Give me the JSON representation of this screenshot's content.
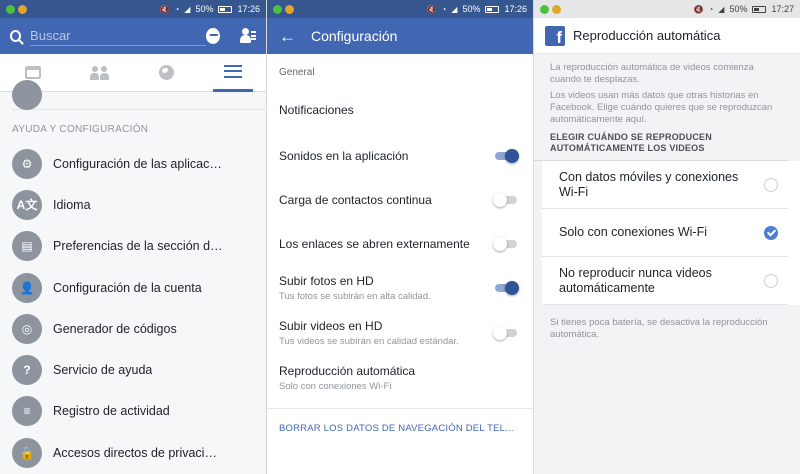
{
  "status_left": {
    "battery": "50%",
    "time": "17:26"
  },
  "status_mid": {
    "battery": "50%",
    "time": "17:26"
  },
  "status_right": {
    "battery": "50%",
    "time": "17:27"
  },
  "menu_screen": {
    "search": {
      "placeholder": "Buscar"
    },
    "section_title": "AYUDA Y CONFIGURACIÓN",
    "items": [
      {
        "label": "Configuración de las aplicacio…",
        "icon": "gear-icon",
        "glyph": "⚙"
      },
      {
        "label": "Idioma",
        "icon": "language-icon",
        "glyph": "A文"
      },
      {
        "label": "Preferencias de la sección de…",
        "icon": "news-feed-preferences-icon",
        "glyph": "▤"
      },
      {
        "label": "Configuración de la cuenta",
        "icon": "account-settings-icon",
        "glyph": "👤"
      },
      {
        "label": "Generador de códigos",
        "icon": "code-generator-icon",
        "glyph": "◎"
      },
      {
        "label": "Servicio de ayuda",
        "icon": "help-icon",
        "glyph": "?"
      },
      {
        "label": "Registro de actividad",
        "icon": "activity-log-icon",
        "glyph": "≡"
      },
      {
        "label": "Accesos directos de privacidad",
        "icon": "privacy-lock-icon",
        "glyph": "🔒"
      }
    ]
  },
  "settings_screen": {
    "title": "Configuración",
    "section": "General",
    "rows": [
      {
        "title": "Notificaciones",
        "subtitle": "",
        "toggle": null
      },
      {
        "title": "Sonidos en la aplicación",
        "subtitle": "",
        "toggle": true
      },
      {
        "title": "Carga de contactos continua",
        "subtitle": "",
        "toggle": false
      },
      {
        "title": "Los enlaces se abren externamente",
        "subtitle": "",
        "toggle": false
      },
      {
        "title": "Subir fotos en HD",
        "subtitle": "Tus fotos se subirán en alta calidad.",
        "toggle": true
      },
      {
        "title": "Subir videos en HD",
        "subtitle": "Tus videos se subirán en calidad estándar.",
        "toggle": false
      },
      {
        "title": "Reproducción automática",
        "subtitle": "Solo con conexiones Wi-Fi",
        "toggle": null
      }
    ],
    "clear_link": "BORRAR LOS DATOS DE NAVEGACIÓN DEL TELÉF…"
  },
  "autoplay_screen": {
    "title": "Reproducción automática",
    "desc1": "La reproducción automática de videos comienza cuando te desplazas.",
    "desc2": "Los videos usan más datos que otras historias en Facebook. Elige cuándo quieres que se reproduzcan automáticamente aquí.",
    "choose_header": "ELEGIR CUÁNDO SE REPRODUCEN AUTOMÁTICAMENTE LOS VIDEOS",
    "options": [
      {
        "label": "Con datos móviles y conexiones Wi-Fi",
        "selected": false
      },
      {
        "label": "Solo con conexiones Wi-Fi",
        "selected": true
      },
      {
        "label": "No reproducir nunca videos automáticamente",
        "selected": false
      }
    ],
    "footnote": "Si tienes poca batería, se desactiva la reproducción automática."
  },
  "colors": {
    "brand_blue": "#4267b2",
    "status_blue": "#36568f",
    "toggle_on": "#2f5498",
    "radio_checked": "#4d7ed3"
  }
}
